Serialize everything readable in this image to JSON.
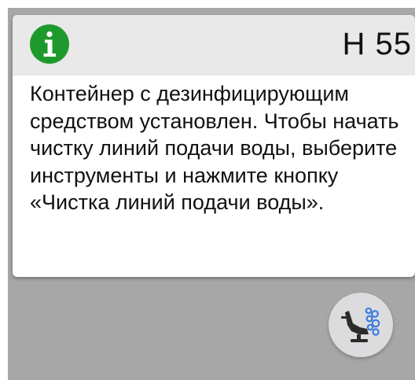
{
  "dialog": {
    "code": "H 55",
    "message": "Контейнер с дезинфицирующим средством установлен. Чтобы начать чистку линий подачи воды, выберите инструменты и нажмите кнопку «Чистка линий подачи воды».",
    "icon": "info-icon",
    "icon_color": "#1e9a2c"
  },
  "action": {
    "icon": "dental-chair-water-cleaning-icon",
    "accent_color": "#3d7be0"
  }
}
